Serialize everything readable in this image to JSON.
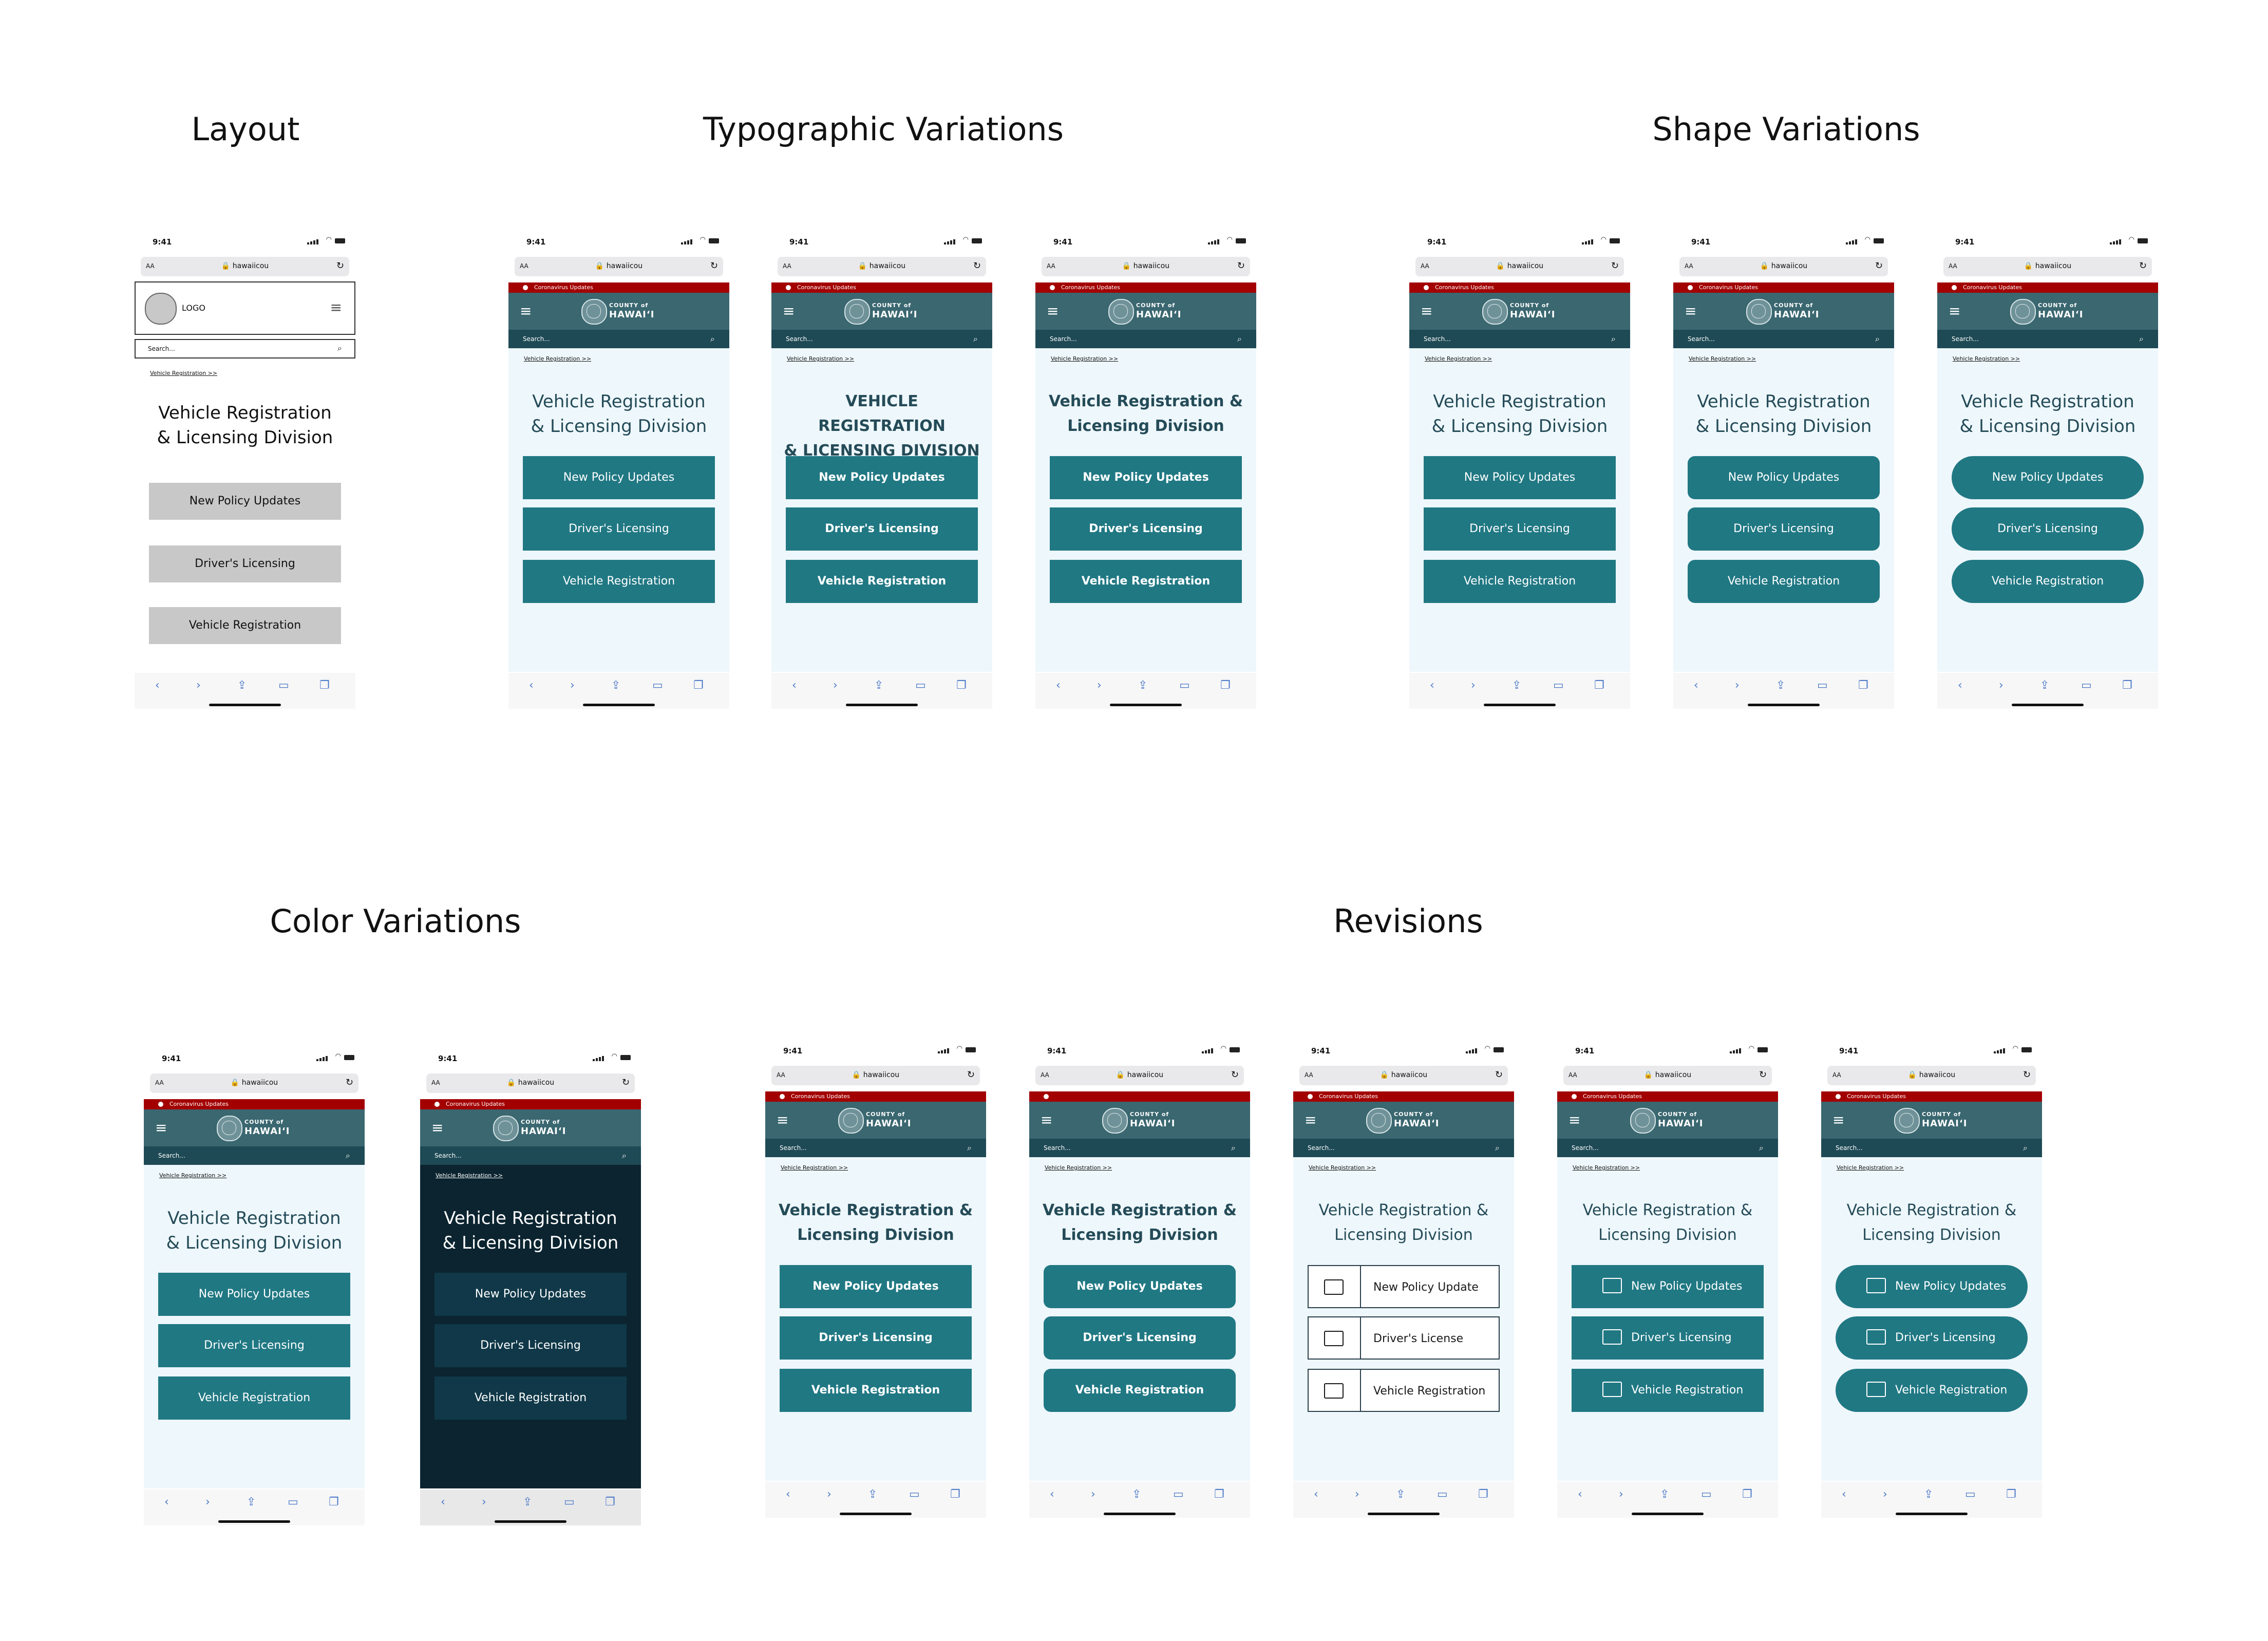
{
  "sections": {
    "layout": "Layout",
    "typographic": "Typographic Variations",
    "shape": "Shape Variations",
    "color": "Color Variations",
    "revisions": "Revisions"
  },
  "phone": {
    "time": "9:41",
    "text_size": "AA",
    "url": "🔒 hawaiicou",
    "alert": "Coronavirus Updates",
    "county": "COUNTY of",
    "hawaii": "HAWAIʻI",
    "search_placeholder": "Search...",
    "breadcrumb": "Vehicle Registration >>",
    "headline": "Vehicle Registration\n& Licensing Division",
    "headline_alt": "Vehicle Registration &\nLicensing Division",
    "headline_caps": "VEHICLE REGISTRATION\n& LICENSING DIVISION",
    "buttons": [
      "New Policy Updates",
      "Driver's Licensing",
      "Vehicle Registration"
    ],
    "buttons_outline": [
      "New Policy Update",
      "Driver's License",
      "Vehicle Registration"
    ]
  },
  "wireframe": {
    "logo": "LOGO"
  },
  "colors": {
    "alert": "#a30000",
    "header": "#3a6770",
    "search": "#1e4a55",
    "content_bg": "#eef7fb",
    "button": "#207883",
    "dark_bg": "#0b2430",
    "dark_button": "#103848"
  }
}
